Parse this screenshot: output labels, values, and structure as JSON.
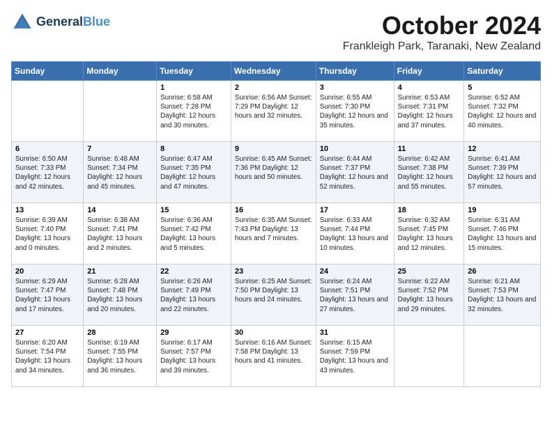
{
  "header": {
    "logo_line1": "General",
    "logo_line2": "Blue",
    "month": "October 2024",
    "location": "Frankleigh Park, Taranaki, New Zealand"
  },
  "weekdays": [
    "Sunday",
    "Monday",
    "Tuesday",
    "Wednesday",
    "Thursday",
    "Friday",
    "Saturday"
  ],
  "weeks": [
    [
      {
        "day": "",
        "detail": ""
      },
      {
        "day": "",
        "detail": ""
      },
      {
        "day": "1",
        "detail": "Sunrise: 6:58 AM\nSunset: 7:28 PM\nDaylight: 12 hours\nand 30 minutes."
      },
      {
        "day": "2",
        "detail": "Sunrise: 6:56 AM\nSunset: 7:29 PM\nDaylight: 12 hours\nand 32 minutes."
      },
      {
        "day": "3",
        "detail": "Sunrise: 6:55 AM\nSunset: 7:30 PM\nDaylight: 12 hours\nand 35 minutes."
      },
      {
        "day": "4",
        "detail": "Sunrise: 6:53 AM\nSunset: 7:31 PM\nDaylight: 12 hours\nand 37 minutes."
      },
      {
        "day": "5",
        "detail": "Sunrise: 6:52 AM\nSunset: 7:32 PM\nDaylight: 12 hours\nand 40 minutes."
      }
    ],
    [
      {
        "day": "6",
        "detail": "Sunrise: 6:50 AM\nSunset: 7:33 PM\nDaylight: 12 hours\nand 42 minutes."
      },
      {
        "day": "7",
        "detail": "Sunrise: 6:48 AM\nSunset: 7:34 PM\nDaylight: 12 hours\nand 45 minutes."
      },
      {
        "day": "8",
        "detail": "Sunrise: 6:47 AM\nSunset: 7:35 PM\nDaylight: 12 hours\nand 47 minutes."
      },
      {
        "day": "9",
        "detail": "Sunrise: 6:45 AM\nSunset: 7:36 PM\nDaylight: 12 hours\nand 50 minutes."
      },
      {
        "day": "10",
        "detail": "Sunrise: 6:44 AM\nSunset: 7:37 PM\nDaylight: 12 hours\nand 52 minutes."
      },
      {
        "day": "11",
        "detail": "Sunrise: 6:42 AM\nSunset: 7:38 PM\nDaylight: 12 hours\nand 55 minutes."
      },
      {
        "day": "12",
        "detail": "Sunrise: 6:41 AM\nSunset: 7:39 PM\nDaylight: 12 hours\nand 57 minutes."
      }
    ],
    [
      {
        "day": "13",
        "detail": "Sunrise: 6:39 AM\nSunset: 7:40 PM\nDaylight: 13 hours\nand 0 minutes."
      },
      {
        "day": "14",
        "detail": "Sunrise: 6:38 AM\nSunset: 7:41 PM\nDaylight: 13 hours\nand 2 minutes."
      },
      {
        "day": "15",
        "detail": "Sunrise: 6:36 AM\nSunset: 7:42 PM\nDaylight: 13 hours\nand 5 minutes."
      },
      {
        "day": "16",
        "detail": "Sunrise: 6:35 AM\nSunset: 7:43 PM\nDaylight: 13 hours\nand 7 minutes."
      },
      {
        "day": "17",
        "detail": "Sunrise: 6:33 AM\nSunset: 7:44 PM\nDaylight: 13 hours\nand 10 minutes."
      },
      {
        "day": "18",
        "detail": "Sunrise: 6:32 AM\nSunset: 7:45 PM\nDaylight: 13 hours\nand 12 minutes."
      },
      {
        "day": "19",
        "detail": "Sunrise: 6:31 AM\nSunset: 7:46 PM\nDaylight: 13 hours\nand 15 minutes."
      }
    ],
    [
      {
        "day": "20",
        "detail": "Sunrise: 6:29 AM\nSunset: 7:47 PM\nDaylight: 13 hours\nand 17 minutes."
      },
      {
        "day": "21",
        "detail": "Sunrise: 6:28 AM\nSunset: 7:48 PM\nDaylight: 13 hours\nand 20 minutes."
      },
      {
        "day": "22",
        "detail": "Sunrise: 6:26 AM\nSunset: 7:49 PM\nDaylight: 13 hours\nand 22 minutes."
      },
      {
        "day": "23",
        "detail": "Sunrise: 6:25 AM\nSunset: 7:50 PM\nDaylight: 13 hours\nand 24 minutes."
      },
      {
        "day": "24",
        "detail": "Sunrise: 6:24 AM\nSunset: 7:51 PM\nDaylight: 13 hours\nand 27 minutes."
      },
      {
        "day": "25",
        "detail": "Sunrise: 6:22 AM\nSunset: 7:52 PM\nDaylight: 13 hours\nand 29 minutes."
      },
      {
        "day": "26",
        "detail": "Sunrise: 6:21 AM\nSunset: 7:53 PM\nDaylight: 13 hours\nand 32 minutes."
      }
    ],
    [
      {
        "day": "27",
        "detail": "Sunrise: 6:20 AM\nSunset: 7:54 PM\nDaylight: 13 hours\nand 34 minutes."
      },
      {
        "day": "28",
        "detail": "Sunrise: 6:19 AM\nSunset: 7:55 PM\nDaylight: 13 hours\nand 36 minutes."
      },
      {
        "day": "29",
        "detail": "Sunrise: 6:17 AM\nSunset: 7:57 PM\nDaylight: 13 hours\nand 39 minutes."
      },
      {
        "day": "30",
        "detail": "Sunrise: 6:16 AM\nSunset: 7:58 PM\nDaylight: 13 hours\nand 41 minutes."
      },
      {
        "day": "31",
        "detail": "Sunrise: 6:15 AM\nSunset: 7:59 PM\nDaylight: 13 hours\nand 43 minutes."
      },
      {
        "day": "",
        "detail": ""
      },
      {
        "day": "",
        "detail": ""
      }
    ]
  ]
}
